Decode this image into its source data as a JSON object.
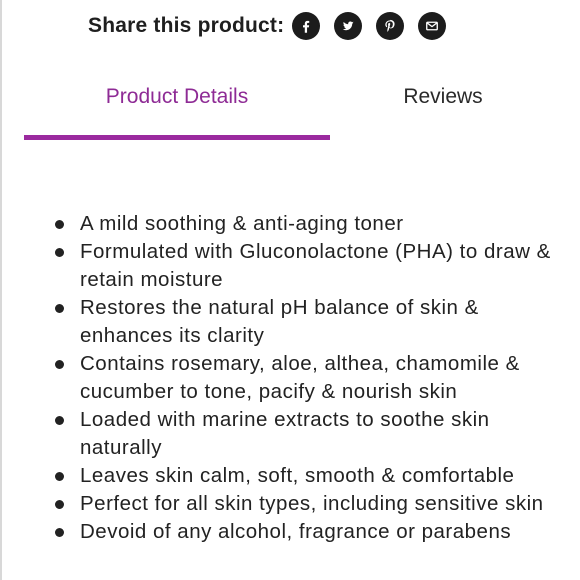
{
  "share": {
    "label": "Share this product:",
    "icons": [
      "facebook-icon",
      "twitter-icon",
      "pinterest-icon",
      "email-icon"
    ]
  },
  "tabs": {
    "details": "Product Details",
    "reviews": "Reviews",
    "active": "Product Details",
    "accent_color": "#9b2a9f"
  },
  "details": {
    "items": [
      "A mild soothing & anti-aging toner",
      "Formulated with Gluconolactone (PHA) to draw & retain moisture",
      "Restores the natural pH balance of skin & enhances its clarity",
      "Contains rosemary, aloe, althea, chamomile & cucumber to tone, pacify & nourish skin",
      "Loaded with marine extracts to soothe skin naturally",
      "Leaves skin calm, soft, smooth & comfortable",
      "Perfect for all skin types, including sensitive skin",
      "Devoid of any alcohol, fragrance or parabens"
    ]
  }
}
